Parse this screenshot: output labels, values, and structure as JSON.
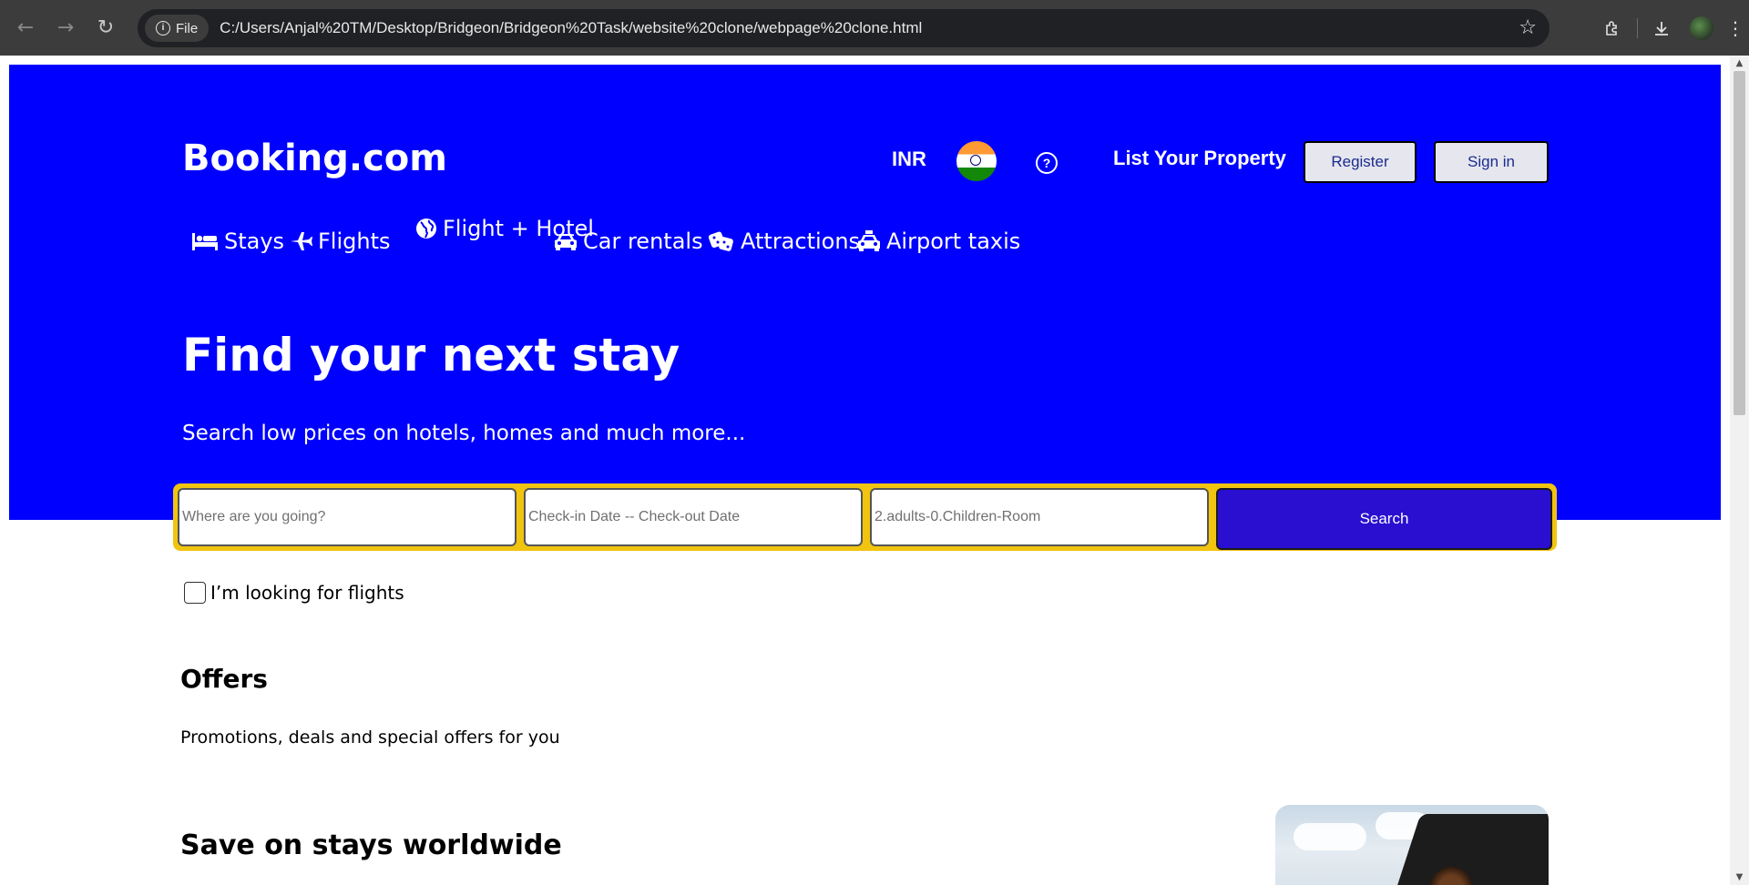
{
  "browser": {
    "file_chip": "File",
    "url": "C:/Users/Anjal%20TM/Desktop/Bridgeon/Bridgeon%20Task/website%20clone/webpage%20clone.html"
  },
  "header": {
    "brand": "Booking.com",
    "currency": "INR",
    "help_glyph": "?",
    "list_property": "List Your Property",
    "register": "Register",
    "sign_in": "Sign in"
  },
  "tabs": [
    {
      "icon": "bed-icon",
      "label": "Stays"
    },
    {
      "icon": "plane-icon",
      "label": "Flights"
    },
    {
      "icon": "globe-icon",
      "label": "Flight + Hotel"
    },
    {
      "icon": "car-icon",
      "label": "Car rentals"
    },
    {
      "icon": "dice-icon",
      "label": "Attractions"
    },
    {
      "icon": "taxi-icon",
      "label": "Airport taxis"
    }
  ],
  "hero": {
    "title": "Find your next stay",
    "subtitle": "Search low prices on hotels, homes and much more..."
  },
  "search": {
    "destination_placeholder": "Where are you going?",
    "dates_placeholder": "Check-in Date -- Check-out Date",
    "guests_placeholder": "2.adults-0.Children-Room",
    "button": "Search"
  },
  "flights_checkbox": {
    "label": "I’m looking for flights",
    "checked": false
  },
  "offers": {
    "title": "Offers",
    "subtitle": "Promotions, deals and special offers for you"
  },
  "promo": {
    "title": "Save on stays worldwide"
  },
  "colors": {
    "hero_bg": "#0000ff",
    "search_border": "#f1c40f",
    "search_button": "#2a0fd0"
  }
}
